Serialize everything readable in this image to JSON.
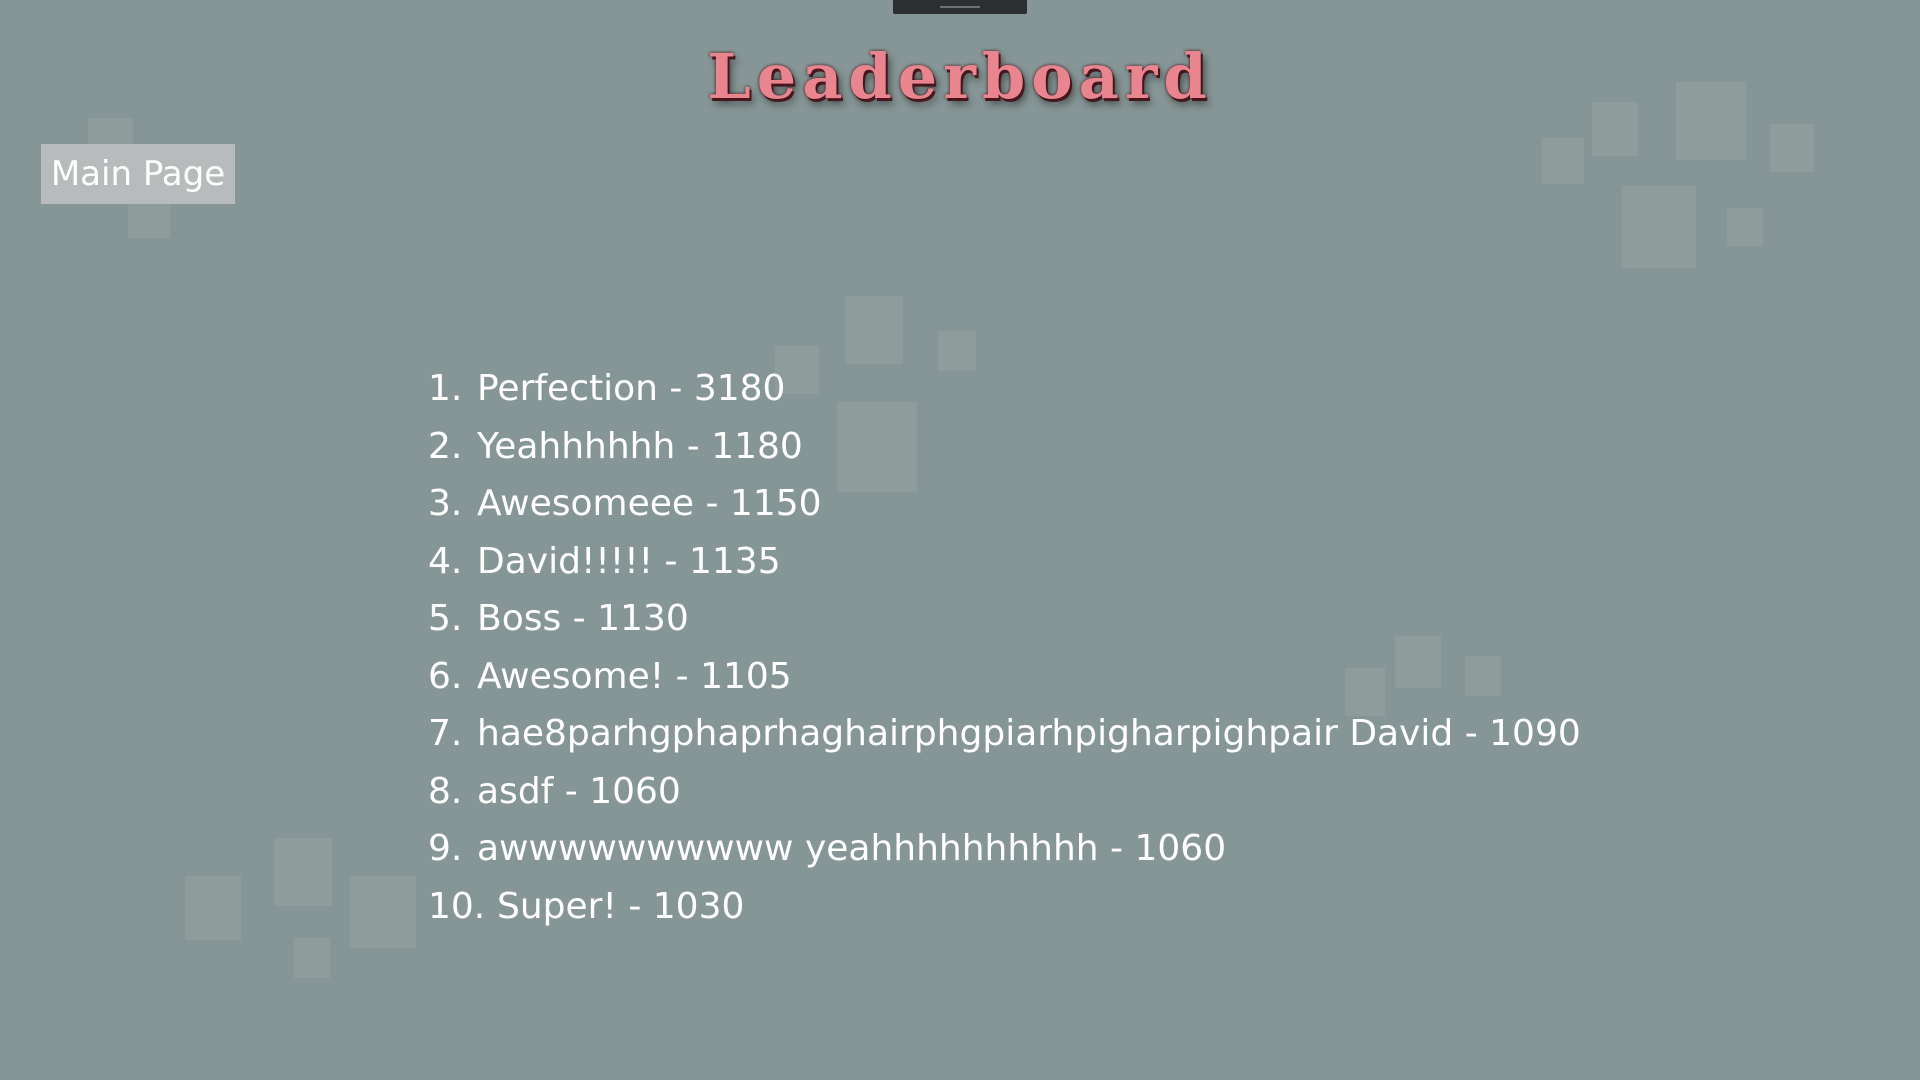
{
  "header": {
    "title": "Leaderboard"
  },
  "nav": {
    "main_page_label": "Main Page"
  },
  "leaderboard": {
    "entries": [
      {
        "rank": "1.",
        "text": "Perfection - 3180"
      },
      {
        "rank": "2.",
        "text": "Yeahhhhhh - 1180"
      },
      {
        "rank": "3.",
        "text": "Awesomeee - 1150"
      },
      {
        "rank": "4.",
        "text": "David!!!!! - 1135"
      },
      {
        "rank": "5.",
        "text": "Boss - 1130"
      },
      {
        "rank": "6.",
        "text": "Awesome! - 1105"
      },
      {
        "rank": "7.",
        "text": "hae8parhgphaprhaghairphgpiarhpigharpighpair David - 1090"
      },
      {
        "rank": "8.",
        "text": "asdf - 1060"
      },
      {
        "rank": "9.",
        "text": "awwwwwwwwww yeahhhhhhhhhh - 1060"
      },
      {
        "rank": "10.",
        "text": "Super! - 1030"
      }
    ]
  },
  "colors": {
    "background": "#869595",
    "title": "#e8858f",
    "button": "#b7bbbb",
    "text": "#ffffff"
  }
}
